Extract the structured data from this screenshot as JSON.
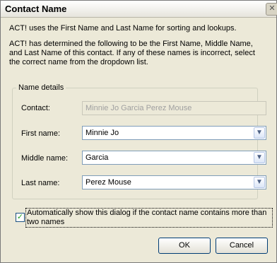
{
  "window": {
    "title": "Contact Name",
    "close_icon": "close-icon"
  },
  "info": {
    "line1": "ACT! uses the First Name and Last Name for sorting and lookups.",
    "line2": "ACT! has determined the following to be the First Name, Middle Name, and Last Name of this contact. If any of these names is incorrect, select the correct name from the dropdown list."
  },
  "group": {
    "legend": "Name details",
    "contact": {
      "label": "Contact:",
      "value": "Minnie Jo Garcia Perez Mouse"
    },
    "first_name": {
      "label": "First name:",
      "value": "Minnie Jo"
    },
    "middle_name": {
      "label": "Middle name:",
      "value": "Garcia"
    },
    "last_name": {
      "label": "Last name:",
      "value": "Perez Mouse"
    },
    "dropdown_icon": "chevron-down-icon"
  },
  "auto_show": {
    "checked": true,
    "label": "Automatically show this dialog if the contact name contains more than two names"
  },
  "buttons": {
    "ok": "OK",
    "cancel": "Cancel"
  }
}
